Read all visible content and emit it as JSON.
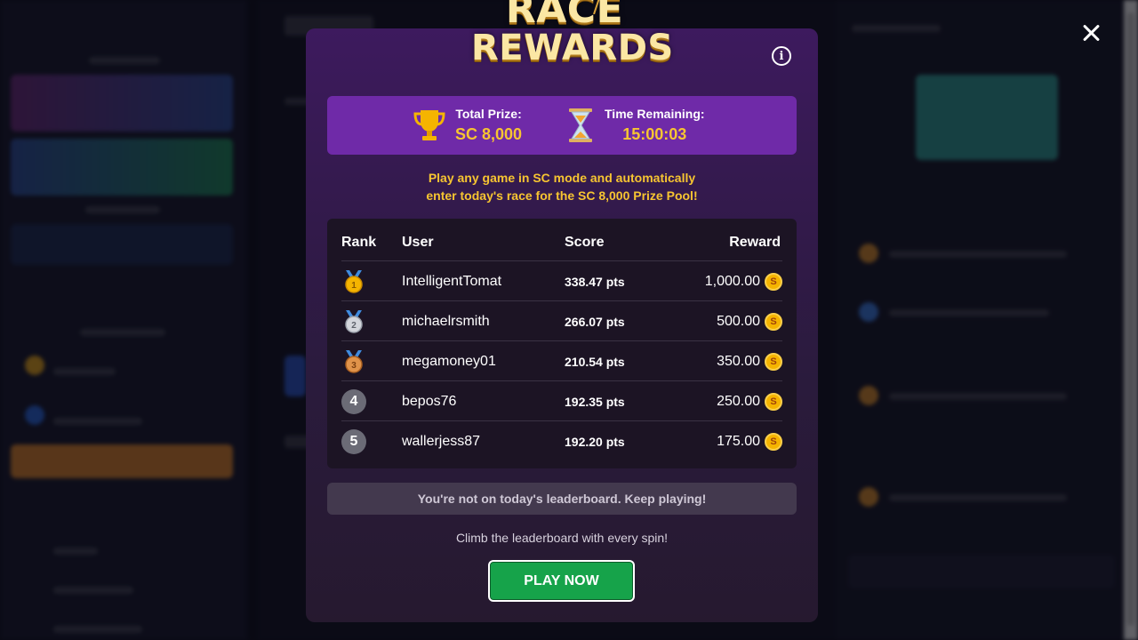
{
  "modal": {
    "logo_line1": "RACE",
    "logo_line2": "REWARDS",
    "total_prize_label": "Total Prize:",
    "total_prize_value": "SC 8,000",
    "time_remaining_label": "Time Remaining:",
    "time_remaining_value": "15:00:03",
    "promo_line1": "Play any game in SC mode and automatically",
    "promo_line2": "enter today's race for the SC 8,000 Prize Pool!",
    "notice": "You're not on today's leaderboard. Keep playing!",
    "climb_text": "Climb the leaderboard with every spin!",
    "play_button": "PLAY NOW",
    "coin_symbol": "S"
  },
  "leaderboard": {
    "headers": {
      "rank": "Rank",
      "user": "User",
      "score": "Score",
      "reward": "Reward"
    },
    "rows": [
      {
        "rank": "1",
        "medal": "gold-medal-icon",
        "user": "IntelligentTomat",
        "score": "338.47 pts",
        "reward": "1,000.00"
      },
      {
        "rank": "2",
        "medal": "silver-medal-icon",
        "user": "michaelrsmith",
        "score": "266.07 pts",
        "reward": "500.00"
      },
      {
        "rank": "3",
        "medal": "bronze-medal-icon",
        "user": "megamoney01",
        "score": "210.54 pts",
        "reward": "350.00"
      },
      {
        "rank": "4",
        "user": "bepos76",
        "score": "192.35 pts",
        "reward": "250.00"
      },
      {
        "rank": "5",
        "user": "wallerjess87",
        "score": "192.20 pts",
        "reward": "175.00"
      }
    ]
  },
  "colors": {
    "accent_gold": "#f7c531",
    "prize_bar": "#6f2aa8",
    "play_button": "#16a34a"
  }
}
